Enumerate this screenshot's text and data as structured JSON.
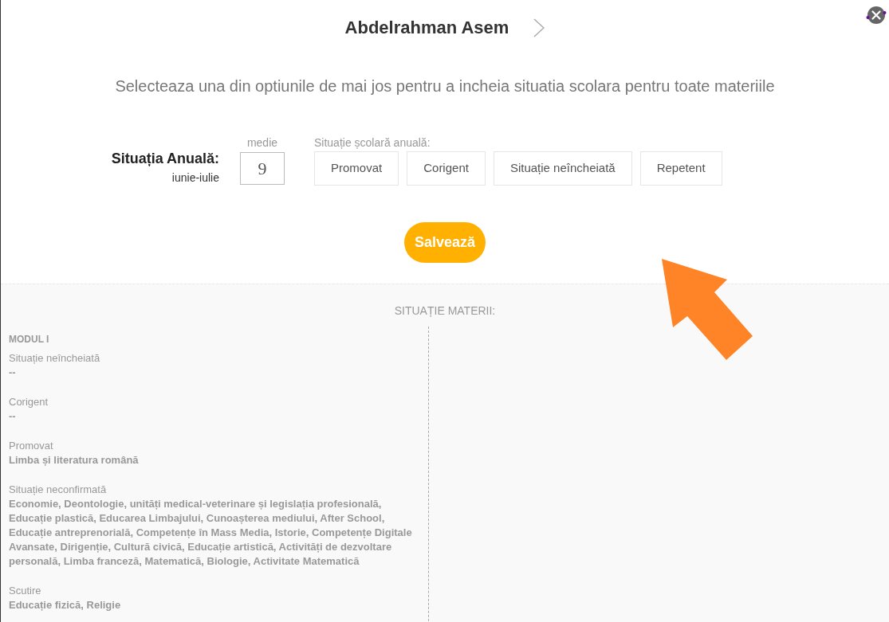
{
  "header": {
    "title": "Abdelrahman Asem"
  },
  "instruction": "Selecteaza una din optiunile de mai jos pentru a incheia situatia scolara pentru toate materiile",
  "annual_situation": {
    "label": "Situația Anuală:",
    "period": "iunie-iulie",
    "average": {
      "label": "medie",
      "value": "9"
    },
    "options_label": "Situație școlară anuală:",
    "options": [
      {
        "label": "Promovat",
        "selected": false
      },
      {
        "label": "Corigent",
        "selected": false
      },
      {
        "label": "Situație neîncheiată",
        "selected": false
      },
      {
        "label": "Repetent",
        "selected": false
      }
    ]
  },
  "save_button": "Salvează",
  "subjects_section": {
    "title": "SITUAȚIE MATERII:",
    "modules": [
      {
        "name": "MODUL I",
        "groups": [
          {
            "label": "Situație neîncheiată",
            "subjects": "--"
          },
          {
            "label": "Corigent",
            "subjects": "--"
          },
          {
            "label": "Promovat",
            "subjects": "Limba și literatura română"
          },
          {
            "label": "Situație neconfirmată",
            "subjects": "Economie, Deontologie, unități medical-veterinare și legislația profesională, Educație plastică, Educarea Limbajului, Cunoașterea mediului, After School, Educație antreprenorială, Competențe în Mass Media, Istorie, Competențe Digitale Avansate, Dirigenție, Cultură civică, Educație artistică, Activități de dezvoltare personală, Limba franceză, Matematică, Biologie, Activitate Matematică"
          },
          {
            "label": "Scutire",
            "subjects": "Educație fizică, Religie"
          }
        ]
      }
    ]
  }
}
